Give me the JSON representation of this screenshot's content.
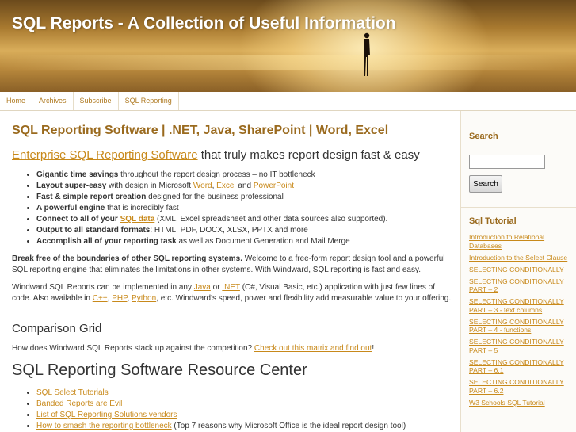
{
  "site": {
    "title": "SQL Reports - A Collection of Useful Information"
  },
  "nav": {
    "items": [
      "Home",
      "Archives",
      "Subscribe",
      "SQL Reporting"
    ]
  },
  "post": {
    "title": "SQL Reporting Software | .NET, Java, SharePoint | Word, Excel",
    "lead_link": "Enterprise SQL Reporting Software",
    "lead_rest": " that truly makes report design fast & easy",
    "features": [
      {
        "bold": "Gigantic time savings",
        "rest": " throughout the report design process – no IT bottleneck"
      },
      {
        "bold": "Layout super-easy",
        "rest": " with design in Microsoft ",
        "link1": "Word",
        "mid1": ", ",
        "link2": "Excel",
        "mid2": " and ",
        "link3": "PowerPoint"
      },
      {
        "bold": "Fast & simple report creation",
        "rest": " designed for the business professional"
      },
      {
        "bold": "A powerful engine",
        "rest": " that is incredibly fast"
      },
      {
        "bold": "Connect to all of your ",
        "link": "SQL data",
        "rest": " (XML, Excel spreadsheet and other data sources also supported)."
      },
      {
        "bold": "Output to all standard formats",
        "rest": ": HTML, PDF, DOCX, XLSX, PPTX and more"
      },
      {
        "bold": "Accomplish all of your reporting task",
        "rest": " as well as Document Generation and Mail Merge"
      }
    ],
    "para1_bold": "Break free of the boundaries of other SQL reporting systems.",
    "para1_rest": " Welcome to a free-form report design tool and a powerful SQL reporting engine that eliminates the limitations in other systems. With Windward, SQL reporting is fast and easy.",
    "para2": {
      "a": "Windward SQL Reports can be implemented in any ",
      "java": "Java",
      "b": " or ",
      "net": ".NET",
      "c": " (C#, Visual Basic, etc.) application with just few lines of code. Also available in ",
      "cpp": "C++",
      "d": ", ",
      "php": "PHP",
      "e": ", ",
      "python": "Python",
      "f": ", etc. Windward's speed, power and flexibility add measurable value to your offering."
    },
    "comparison_heading": "Comparison Grid",
    "comparison_text": "How does Windward SQL Reports stack up against the competition? ",
    "comparison_link": "Check out this matrix and find out",
    "comparison_end": "!",
    "resource_heading": "SQL Reporting Software Resource Center",
    "resources": [
      {
        "link": "SQL Select Tutorials",
        "rest": ""
      },
      {
        "link": "Banded Reports are Evil",
        "rest": ""
      },
      {
        "link": "List of SQL Reporting Solutions vendors",
        "rest": ""
      },
      {
        "link": "How to smash the reporting bottleneck",
        "rest": " (Top 7 reasons why Microsoft Office is the ideal report design tool)"
      }
    ]
  },
  "sidebar": {
    "search_heading": "Search",
    "search_value": "",
    "search_button": "Search",
    "tutorial_heading": "Sql Tutorial",
    "tutorials": [
      "Introduction to Relational Databases",
      "Introduction to the Select Clause",
      "SELECTING CONDITIONALLY",
      "SELECTING CONDITIONALLY PART – 2",
      "SELECTING CONDITIONALLY PART – 3 - text columns",
      "SELECTING CONDITIONALLY PART – 4 - functions",
      "SELECTING CONDITIONALLY PART – 5",
      "SELECTING CONDITIONALLY PART – 6.1",
      "SELECTING CONDITIONALLY PART – 6.2",
      "W3 Schools SQL Tutorial"
    ]
  },
  "colors": {
    "accent": "#c8891a",
    "heading": "#9a6a1e"
  }
}
